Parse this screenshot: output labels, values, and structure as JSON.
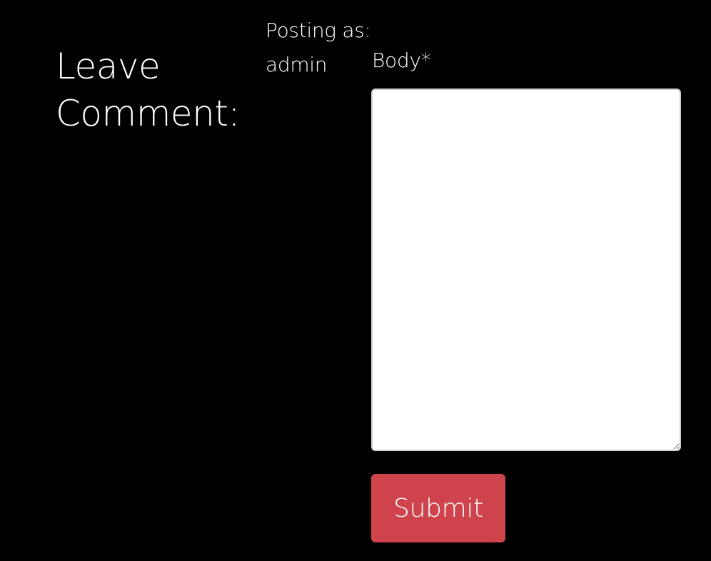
{
  "form": {
    "heading_line1": "Leave",
    "heading_line2": "Comment:",
    "posting_label": "Posting as:",
    "posting_user": "admin",
    "body_label": "Body*",
    "body_value": "",
    "submit_label": "Submit"
  },
  "colors": {
    "background": "#000000",
    "text": "#ffffff",
    "submit_button": "#cf444c",
    "textarea_background": "#ffffff"
  }
}
